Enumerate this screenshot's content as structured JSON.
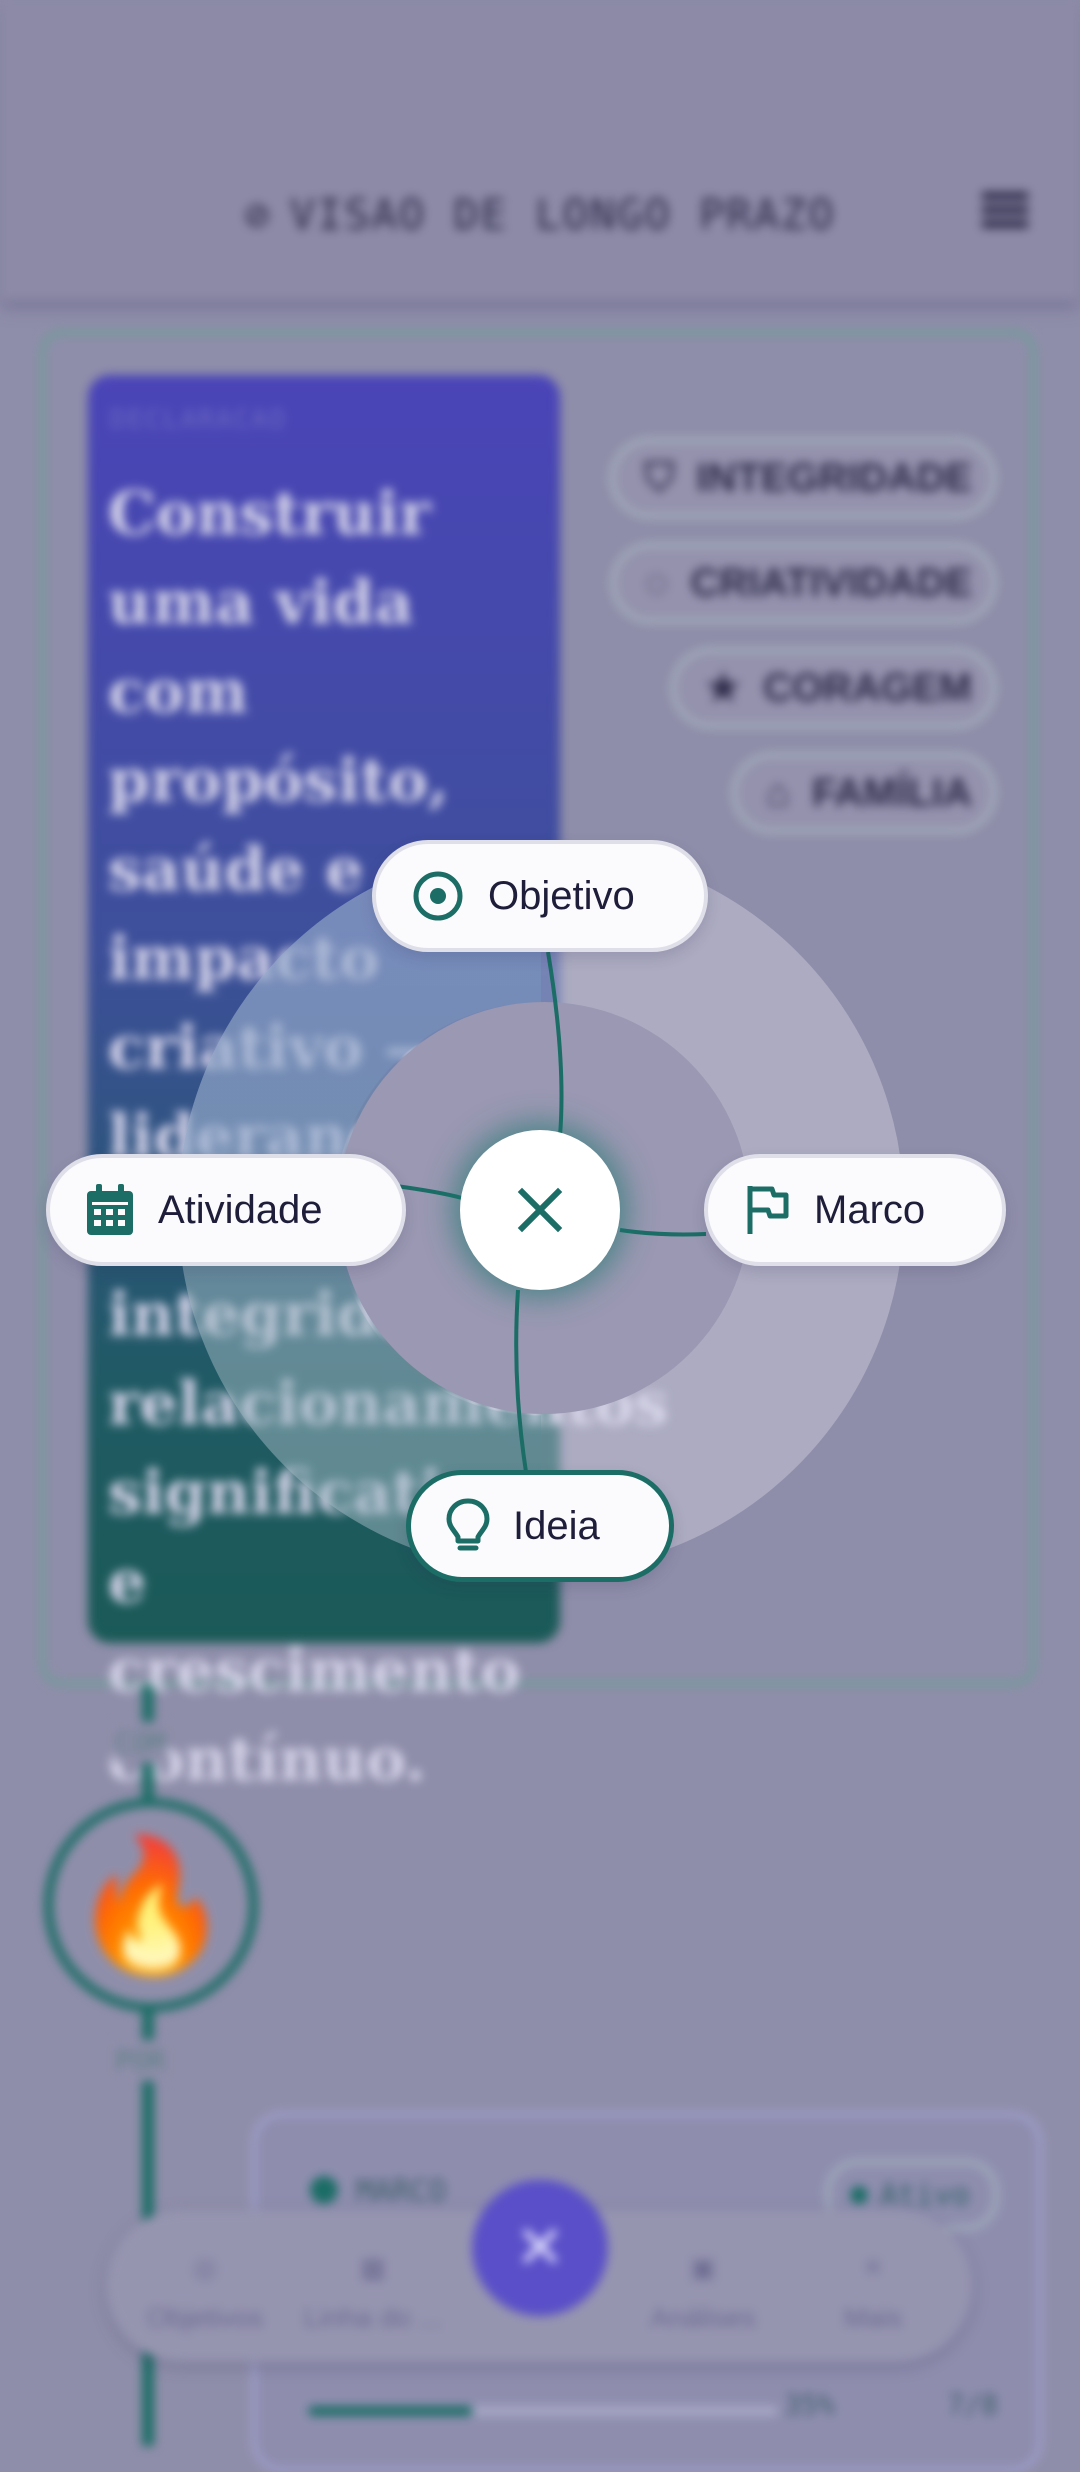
{
  "app_bar": {
    "title": "VISAO DE LONGO PRAZO",
    "title_icon": "compass-icon",
    "menu_icon": "menu-icon"
  },
  "vision": {
    "kicker": "DECLARACAO",
    "statement": "Construir uma vida com propósito, saúde e impacto criativo — liderando com integridade, relacionamentos significativos e crescimento contínuo.",
    "values": [
      {
        "label": "INTEGRIDADE",
        "icon": "shield-icon"
      },
      {
        "label": "CRIATIVIDADE",
        "icon": "palette-icon"
      },
      {
        "label": "CORAGEM",
        "icon": "star-icon"
      },
      {
        "label": "FAMÍLIA",
        "icon": "home-icon"
      }
    ]
  },
  "timeline": {
    "label_top": "COM",
    "label_bottom": "POR",
    "emoji": "🔥"
  },
  "marco_card": {
    "label": "MARCO",
    "status": "Ativo",
    "progress": 0.35,
    "percent": "35%",
    "count": "7/8"
  },
  "quick_add": {
    "options": [
      {
        "id": "objetivo",
        "label": "Objetivo",
        "icon": "target-icon"
      },
      {
        "id": "atividade",
        "label": "Atividade",
        "icon": "calendar-icon"
      },
      {
        "id": "marco",
        "label": "Marco",
        "icon": "flag-icon"
      },
      {
        "id": "ideia",
        "label": "Ideia",
        "icon": "lightbulb-icon",
        "selected": true
      }
    ],
    "close_icon": "close-icon"
  },
  "bottom_nav": {
    "items": [
      {
        "label": "Objetivos",
        "icon": "target-icon"
      },
      {
        "label": "Linha do ...",
        "icon": "calendar-icon"
      },
      {
        "label": "Análises",
        "icon": "dashboard-icon"
      },
      {
        "label": "Mais",
        "icon": "menu-icon"
      }
    ],
    "fab_icon": "close-icon"
  },
  "colors": {
    "accent": "#1b6d66",
    "primary": "#5a4fc8",
    "scrim": "#8f8eaa"
  }
}
